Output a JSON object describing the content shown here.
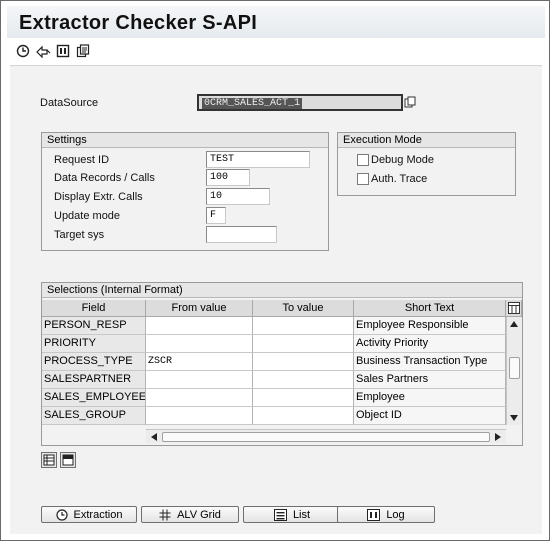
{
  "window": {
    "title": "Extractor Checker S-API"
  },
  "toolbar": {
    "icons": [
      "execute-clock-icon",
      "return-icon",
      "table-icon",
      "copy-icon"
    ]
  },
  "datasource": {
    "label": "DataSource",
    "value": "0CRM_SALES_ACT_1"
  },
  "settings": {
    "title": "Settings",
    "request_id": {
      "label": "Request ID",
      "value": "TEST"
    },
    "data_records": {
      "label": "Data Records / Calls",
      "value": "100"
    },
    "display_calls": {
      "label": "Display Extr. Calls",
      "value": "10"
    },
    "update_mode": {
      "label": "Update mode",
      "value": "F"
    },
    "target_sys": {
      "label": "Target sys",
      "value": ""
    }
  },
  "execution_mode": {
    "title": "Execution Mode",
    "debug_mode": {
      "label": "Debug Mode",
      "checked": false
    },
    "auth_trace": {
      "label": "Auth. Trace",
      "checked": false
    }
  },
  "selections": {
    "title": "Selections (Internal Format)",
    "columns": [
      "Field",
      "From value",
      "To value",
      "Short Text"
    ],
    "rows": [
      {
        "field": "PERSON_RESP",
        "from": "",
        "to": "",
        "text": "Employee Responsible"
      },
      {
        "field": "PRIORITY",
        "from": "",
        "to": "",
        "text": "Activity Priority"
      },
      {
        "field": "PROCESS_TYPE",
        "from": "ZSCR",
        "to": "",
        "text": "Business Transaction Type"
      },
      {
        "field": "SALESPARTNER",
        "from": "",
        "to": "",
        "text": "Sales Partners"
      },
      {
        "field": "SALES_EMPLOYEE",
        "from": "",
        "to": "",
        "text": "Employee"
      },
      {
        "field": "SALES_GROUP",
        "from": "",
        "to": "",
        "text": "Object ID"
      }
    ]
  },
  "buttons": {
    "extraction": "Extraction",
    "alv_grid": "ALV Grid",
    "list": "List",
    "log": "Log"
  }
}
